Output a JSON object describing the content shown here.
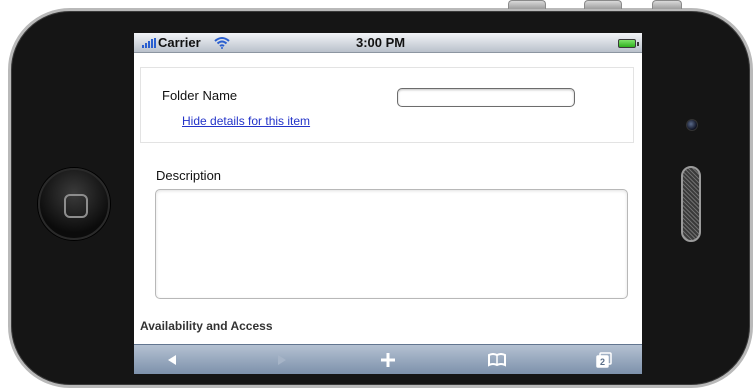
{
  "status_bar": {
    "carrier": "Carrier",
    "time": "3:00 PM"
  },
  "form": {
    "folder_name_label": "Folder Name",
    "folder_name_value": "",
    "hide_details_link": "Hide details for this item",
    "description_label": "Description",
    "description_value": "",
    "availability_label": "Availability and Access"
  },
  "toolbar": {
    "tabs_count": "2",
    "icons": [
      "back-arrow-icon",
      "forward-arrow-icon",
      "add-plus-icon",
      "bookmarks-book-icon",
      "tabs-pages-icon"
    ]
  },
  "colors": {
    "link": "#2333c9",
    "toolbar_top": "#b4c1d2",
    "toolbar_bottom": "#7d91ab",
    "battery": "#2fb01e",
    "signal": "#2a5fd0"
  }
}
